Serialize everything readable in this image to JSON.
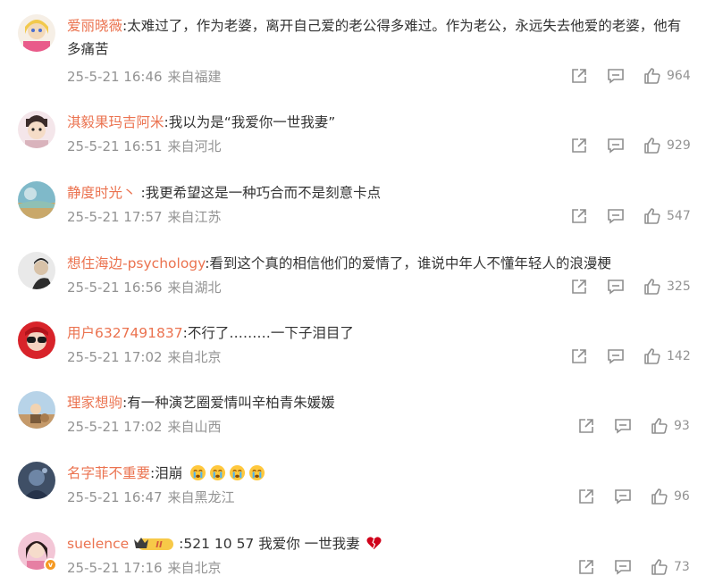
{
  "comments": [
    {
      "user": "爱丽晓薇",
      "sep": ":",
      "content": "太难过了，作为老婆，离开自己爱的老公得多难过。作为老公，永远失去他爱的老婆，他有多痛苦",
      "date": "25-5-21 16:46",
      "location": "来自福建",
      "likes": "964"
    },
    {
      "user": "淇毅果玛吉阿米",
      "sep": ":",
      "content": "我以为是“我爱你一世我妻”",
      "date": "25-5-21 16:51",
      "location": "来自河北",
      "likes": "929"
    },
    {
      "user": "静度时光丶",
      "sep": " :",
      "content": "我更希望这是一种巧合而不是刻意卡点",
      "date": "25-5-21 17:57",
      "location": "来自江苏",
      "likes": "547"
    },
    {
      "user": "想住海边-psychology",
      "sep": ":",
      "content": "看到这个真的相信他们的爱情了，谁说中年人不懂年轻人的浪漫梗",
      "date": "25-5-21 16:56",
      "location": "来自湖北",
      "likes": "325"
    },
    {
      "user": "用户6327491837",
      "sep": ":",
      "content": "不行了………一下子泪目了",
      "date": "25-5-21 17:02",
      "location": "来自北京",
      "likes": "142"
    },
    {
      "user": "理家想驹",
      "sep": ":",
      "content": "有一种演艺圈爱情叫辛柏青朱媛媛",
      "date": "25-5-21 17:02",
      "location": "来自山西",
      "likes": "93"
    },
    {
      "user": "名字菲不重要",
      "sep": ":",
      "content": "泪崩",
      "date": "25-5-21 16:47",
      "location": "来自黑龙江",
      "likes": "96"
    },
    {
      "user": "suelence",
      "sep": ":",
      "content": "521  10 57 我爱你 一世我妻",
      "date": "25-5-21 17:16",
      "location": "来自北京",
      "likes": "73"
    }
  ],
  "icons": {
    "share": "share-icon",
    "comment": "comment-icon",
    "like": "like-icon",
    "cry": "cry-emoji-icon",
    "heart": "broken-heart-icon",
    "vip": "vip-crown-badge",
    "verified": "verified-v-badge"
  },
  "vip_badge_text": "II",
  "verified_badge_text": "v",
  "colors": {
    "username": "#eb7350",
    "meta": "#939393",
    "text": "#333333"
  }
}
